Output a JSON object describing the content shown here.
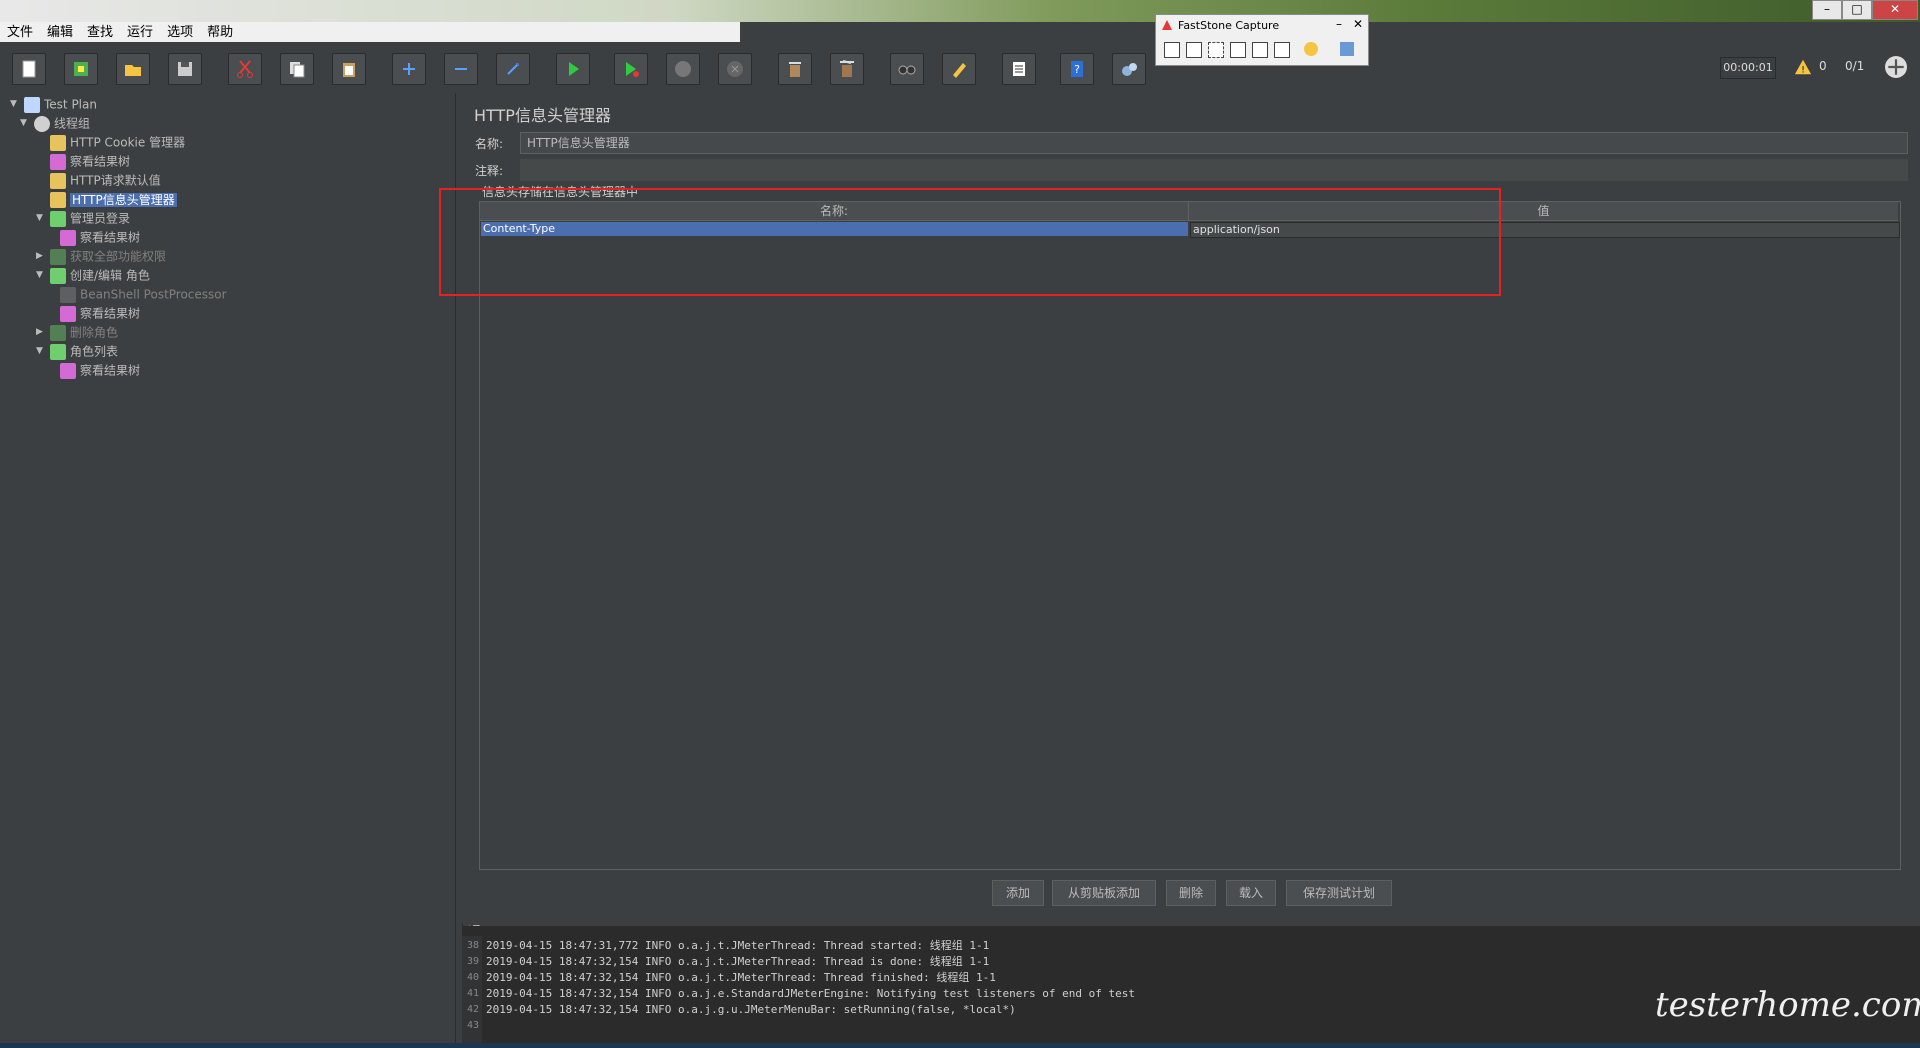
{
  "menu": [
    "文件",
    "编辑",
    "查找",
    "运行",
    "选项",
    "帮助"
  ],
  "faststone": {
    "title": "FastStone Capture"
  },
  "status": {
    "timer": "00:00:01",
    "warnings": "0",
    "threads": "0/1"
  },
  "toolbar": {
    "icons": [
      "new-icon",
      "templates-icon",
      "open-icon",
      "save-icon",
      "cut-icon",
      "copy-icon",
      "paste-icon",
      "expand-icon",
      "collapse-icon",
      "toggle-icon",
      "start-icon",
      "start-no-pause-icon",
      "stop-icon",
      "shutdown-icon",
      "clear-icon",
      "clear-all-icon",
      "search-icon",
      "reset-search-icon",
      "function-helper-icon",
      "help-icon",
      "remote-icon"
    ]
  },
  "tree": {
    "nodes": [
      {
        "label": "Test Plan",
        "icon": "test-plan-icon",
        "level": 0,
        "expander": "down"
      },
      {
        "label": "线程组",
        "icon": "gear-icon",
        "level": 1,
        "expander": "down"
      },
      {
        "label": "HTTP Cookie 管理器",
        "icon": "config-tool-icon",
        "level": 2
      },
      {
        "label": "察看结果树",
        "icon": "listener-icon",
        "level": 2
      },
      {
        "label": "HTTP请求默认值",
        "icon": "config-tool-icon",
        "level": 2
      },
      {
        "label": "HTTP信息头管理器",
        "icon": "config-tool-icon",
        "level": 2,
        "selected": true
      },
      {
        "label": "管理员登录",
        "icon": "sampler-icon",
        "level": 2,
        "expander": "down"
      },
      {
        "label": "察看结果树",
        "icon": "listener-icon",
        "level": 3
      },
      {
        "label": "获取全部功能权限",
        "icon": "sampler-icon",
        "level": 2,
        "expander": "right",
        "disabled": true
      },
      {
        "label": "创建/编辑 角色",
        "icon": "sampler-icon",
        "level": 2,
        "expander": "down"
      },
      {
        "label": "BeanShell PostProcessor",
        "icon": "postprocessor-icon",
        "level": 3,
        "disabled": true
      },
      {
        "label": "察看结果树",
        "icon": "listener-icon",
        "level": 3
      },
      {
        "label": "删除角色",
        "icon": "sampler-icon",
        "level": 2,
        "expander": "right",
        "disabled": true
      },
      {
        "label": "角色列表",
        "icon": "sampler-icon",
        "level": 2,
        "expander": "down"
      },
      {
        "label": "察看结果树",
        "icon": "listener-icon",
        "level": 3
      }
    ]
  },
  "panel": {
    "title": "HTTP信息头管理器",
    "name_label": "名称:",
    "name_value": "HTTP信息头管理器",
    "comment_label": "注释:",
    "comment_value": "",
    "section_label": "信息头存储在信息头管理器中",
    "table": {
      "headers": [
        "名称:",
        "值"
      ],
      "rows": [
        [
          "Content-Type",
          "application/json"
        ]
      ]
    },
    "buttons": [
      "添加",
      "从剪贴板添加",
      "删除",
      "载入",
      "保存测试计划"
    ]
  },
  "log": {
    "lines": [
      {
        "n": "38",
        "text": "2019-04-15 18:47:31,772 INFO o.a.j.t.JMeterThread: Thread started: 线程组 1-1"
      },
      {
        "n": "39",
        "text": "2019-04-15 18:47:32,154 INFO o.a.j.t.JMeterThread: Thread is done: 线程组 1-1"
      },
      {
        "n": "40",
        "text": "2019-04-15 18:47:32,154 INFO o.a.j.t.JMeterThread: Thread finished: 线程组 1-1"
      },
      {
        "n": "41",
        "text": "2019-04-15 18:47:32,154 INFO o.a.j.e.StandardJMeterEngine: Notifying test listeners of end of test"
      },
      {
        "n": "42",
        "text": "2019-04-15 18:47:32,154 INFO o.a.j.g.u.JMeterMenuBar: setRunning(false, *local*)"
      },
      {
        "n": "43",
        "text": ""
      }
    ]
  },
  "watermark": "testerhome.com"
}
